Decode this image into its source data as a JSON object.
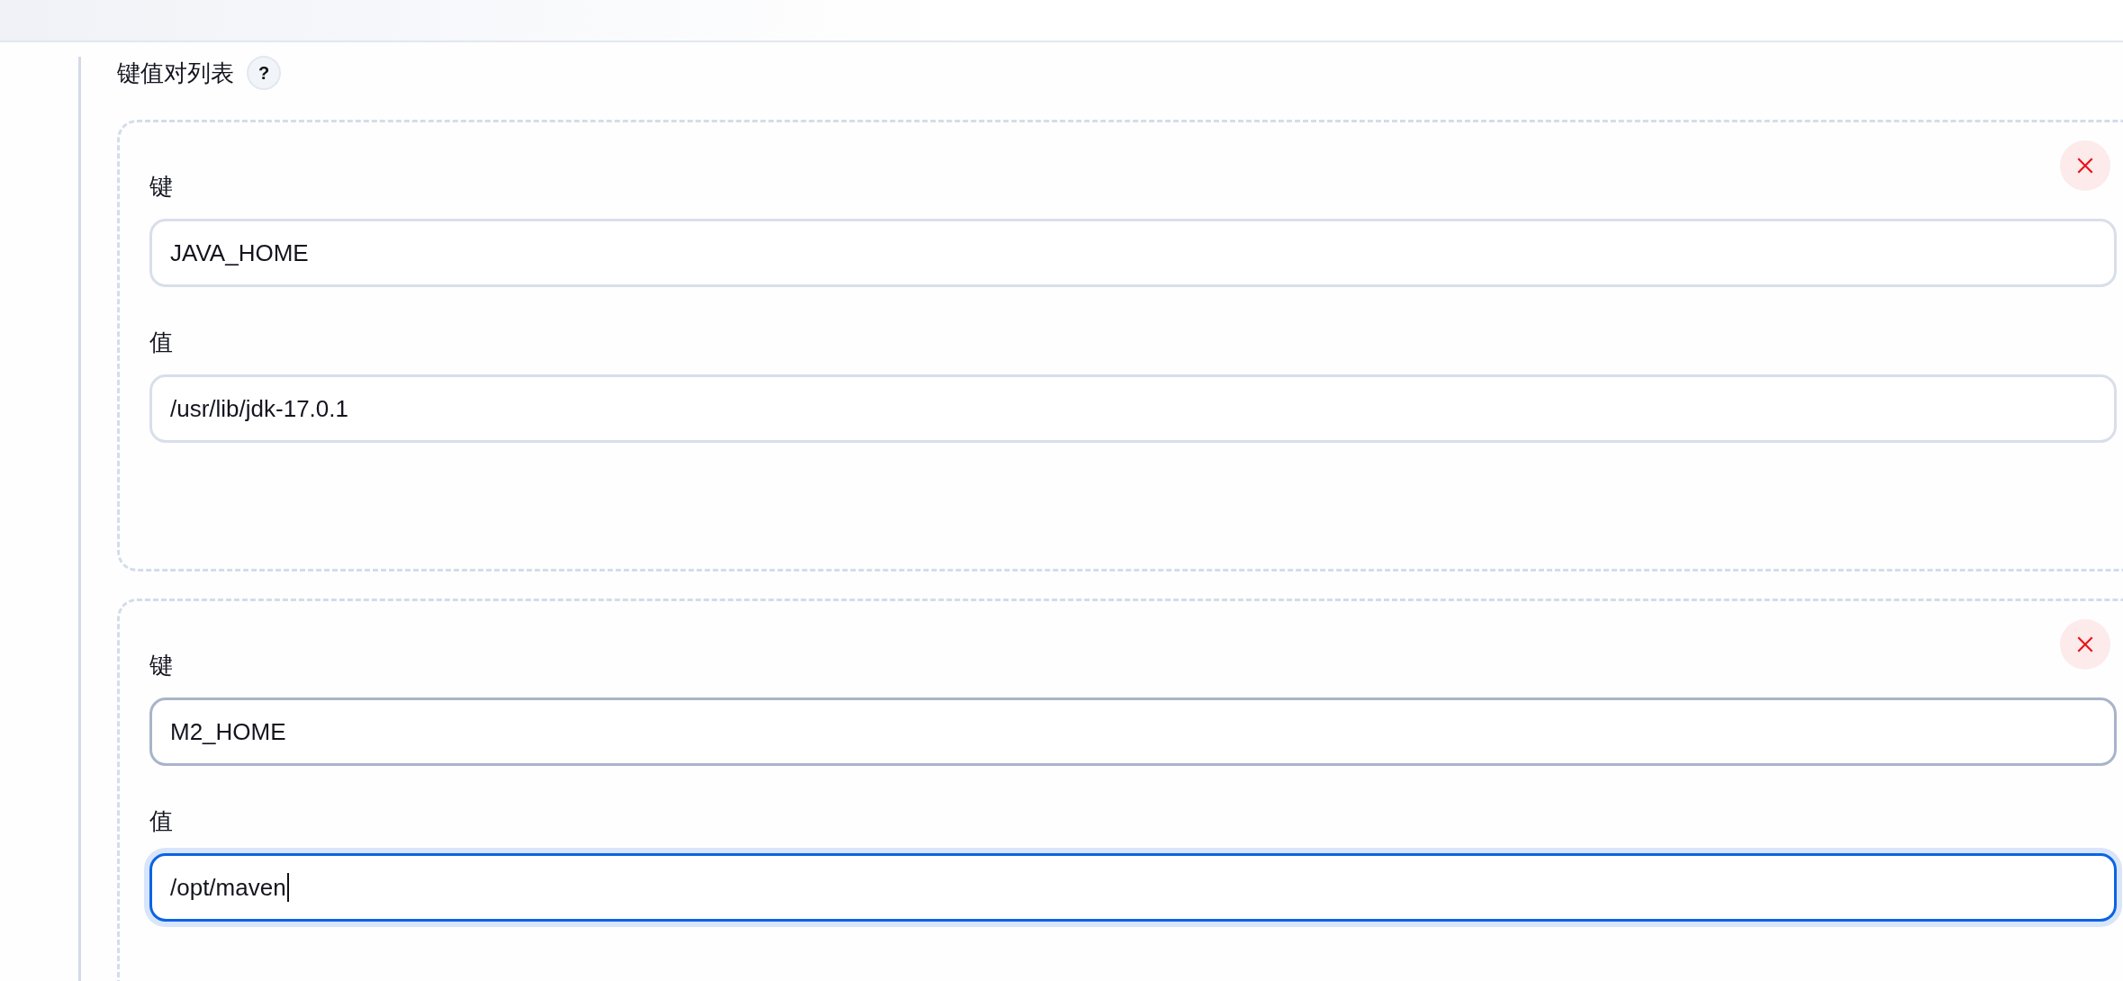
{
  "section": {
    "title": "键值对列表",
    "help": "?"
  },
  "entries": [
    {
      "key": {
        "label": "键",
        "value": "JAVA_HOME",
        "hovered": false,
        "focused": false
      },
      "value": {
        "label": "值",
        "value": "/usr/lib/jdk-17.0.1",
        "hovered": false,
        "focused": false
      }
    },
    {
      "key": {
        "label": "键",
        "value": "M2_HOME",
        "hovered": true,
        "focused": false
      },
      "value": {
        "label": "值",
        "value": "/opt/maven",
        "hovered": false,
        "focused": true
      }
    }
  ]
}
